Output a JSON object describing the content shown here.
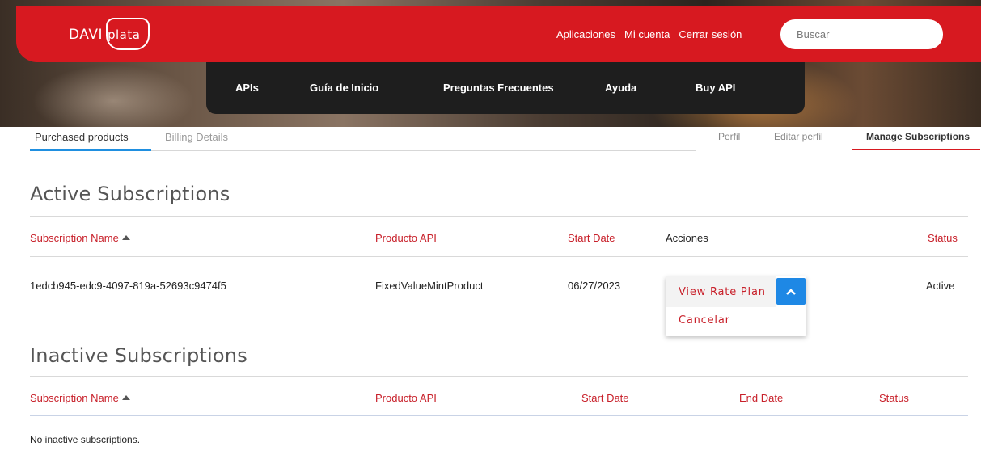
{
  "brand": {
    "logo_text": "DAVIplata",
    "logo_prefix": "DAVI",
    "logo_suffix": "plata",
    "color": "#d71920"
  },
  "header": {
    "links": [
      "Aplicaciones",
      "Mi cuenta",
      "Cerrar sesión"
    ],
    "search": {
      "placeholder": "Buscar",
      "value": ""
    }
  },
  "nav": {
    "items": [
      "APIs",
      "Guía de Inicio",
      "Preguntas Frecuentes",
      "Ayuda",
      "Buy API"
    ]
  },
  "tabs": {
    "purchased": "Purchased products",
    "billing": "Billing Details",
    "active": "Purchased products"
  },
  "profile_tabs": {
    "perfil": "Perfil",
    "editar": "Editar perfil",
    "manage": "Manage Subscriptions",
    "active": "Manage Subscriptions"
  },
  "active_subscriptions": {
    "title": "Active Subscriptions",
    "columns": {
      "name": "Subscription Name",
      "product": "Producto API",
      "start": "Start Date",
      "actions": "Acciones",
      "status": "Status"
    },
    "rows": [
      {
        "name": "1edcb945-edc9-4097-819a-52693c9474f5",
        "product": "FixedValueMintProduct",
        "start": "06/27/2023",
        "status": "Active"
      }
    ],
    "actions_menu": {
      "primary": "View Rate Plan",
      "secondary": "Cancelar",
      "expanded": true
    }
  },
  "inactive_subscriptions": {
    "title": "Inactive Subscriptions",
    "columns": {
      "name": "Subscription Name",
      "product": "Producto API",
      "start": "Start Date",
      "end": "End Date",
      "status": "Status"
    },
    "empty_message": "No inactive subscriptions."
  },
  "colors": {
    "accent_red": "#c8202a",
    "accent_blue": "#1e88e5",
    "nav_dark": "#1e1e1e"
  },
  "icons": {
    "sort": "sort-ascending-icon",
    "toggle": "chevron-up-icon"
  }
}
